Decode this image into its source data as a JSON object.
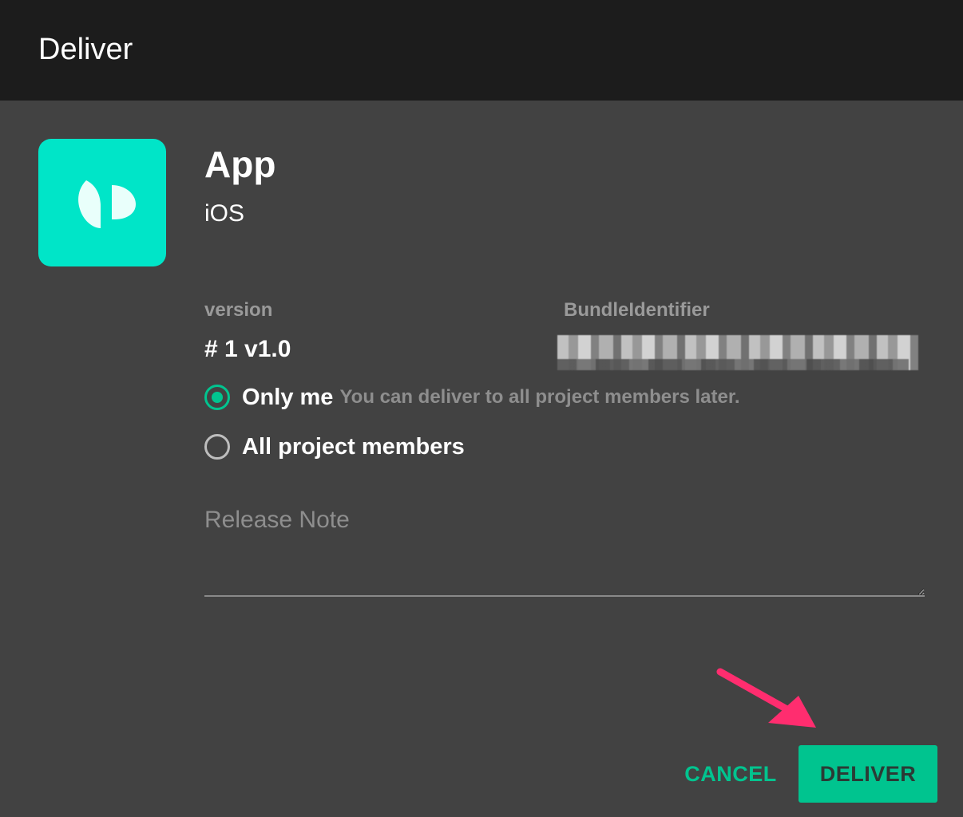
{
  "dialog": {
    "title": "Deliver"
  },
  "app": {
    "icon": "app-logo-icon",
    "icon_color": "#00e5c8",
    "name": "App",
    "platform": "iOS"
  },
  "fields": {
    "version_label": "version",
    "version_value": "# 1 v1.0",
    "bundle_label": "BundleIdentifier"
  },
  "delivery": {
    "only_me_label": "Only me",
    "only_me_hint": "You can deliver to all project members later.",
    "all_members_label": "All project members",
    "selected": "only_me"
  },
  "release_note": {
    "placeholder": "Release Note"
  },
  "actions": {
    "cancel_label": "CANCEL",
    "deliver_label": "DELIVER",
    "accent_color": "#00c48f"
  },
  "annotation": {
    "arrow_color": "#ff2d6f"
  }
}
